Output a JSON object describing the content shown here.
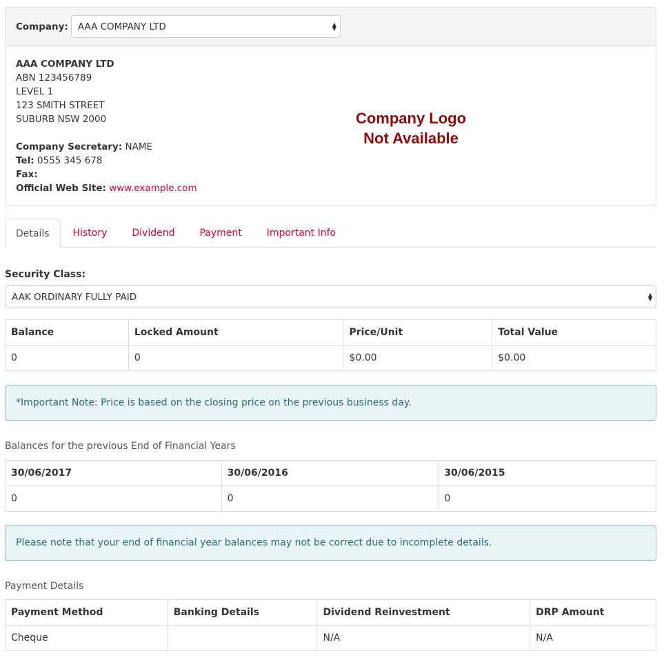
{
  "company_select": {
    "label": "Company:",
    "value": "AAA COMPANY LTD"
  },
  "company": {
    "name": "AAA COMPANY LTD",
    "abn": "ABN 123456789",
    "address1": "LEVEL 1",
    "address2": "123 SMITH STREET",
    "address3": "SUBURB NSW 2000",
    "secretary_label": "Company Secretary:",
    "secretary": "NAME",
    "tel_label": "Tel:",
    "tel": "0555 345 678",
    "fax_label": "Fax:",
    "fax": "",
    "web_label": "Official Web Site:",
    "web": "www.example.com",
    "logo_line1": "Company Logo",
    "logo_line2": "Not Available"
  },
  "tabs": [
    {
      "label": "Details",
      "active": true
    },
    {
      "label": "History"
    },
    {
      "label": "Dividend"
    },
    {
      "label": "Payment"
    },
    {
      "label": "Important Info"
    }
  ],
  "security": {
    "label": "Security Class:",
    "value": "AAK ORDINARY FULLY PAID",
    "columns": [
      "Balance",
      "Locked Amount",
      "Price/Unit",
      "Total Value"
    ],
    "row": [
      "0",
      "0",
      "$0.00",
      "$0.00"
    ]
  },
  "price_note": "*Important Note: Price is based on the closing price on the previous business day.",
  "eofy": {
    "heading": "Balances for the previous End of Financial Years",
    "columns": [
      "30/06/2017",
      "30/06/2016",
      "30/06/2015"
    ],
    "row": [
      "0",
      "0",
      "0"
    ]
  },
  "eofy_note": "Please note that your end of financial year balances may not be correct due to incomplete details.",
  "payment": {
    "heading": "Payment Details",
    "columns": [
      "Payment Method",
      "Banking Details",
      "Dividend Reinvestment",
      "DRP Amount"
    ],
    "row": [
      "Cheque",
      "",
      "N/A",
      "N/A"
    ]
  }
}
